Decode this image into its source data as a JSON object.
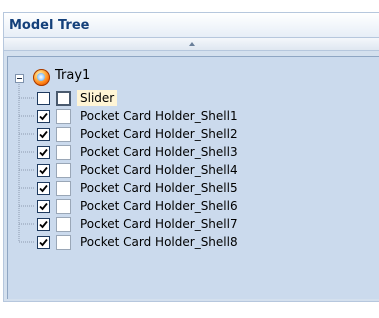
{
  "panel": {
    "title": "Model Tree",
    "collapse_label": "▲"
  },
  "tree": {
    "root": {
      "label": "Tray1",
      "expanded": true,
      "icon": "assembly-icon"
    },
    "items": [
      {
        "label": "Slider",
        "checked": false,
        "selected": true
      },
      {
        "label": "Pocket Card Holder_Shell1",
        "checked": true,
        "selected": false
      },
      {
        "label": "Pocket Card Holder_Shell2",
        "checked": true,
        "selected": false
      },
      {
        "label": "Pocket Card Holder_Shell3",
        "checked": true,
        "selected": false
      },
      {
        "label": "Pocket Card Holder_Shell4",
        "checked": true,
        "selected": false
      },
      {
        "label": "Pocket Card Holder_Shell5",
        "checked": true,
        "selected": false
      },
      {
        "label": "Pocket Card Holder_Shell6",
        "checked": true,
        "selected": false
      },
      {
        "label": "Pocket Card Holder_Shell7",
        "checked": true,
        "selected": false
      },
      {
        "label": "Pocket Card Holder_Shell8",
        "checked": true,
        "selected": false
      }
    ]
  },
  "colors": {
    "panel_bg": "#d4e0ee",
    "tree_bg": "#cbdaed",
    "header_text": "#14407a",
    "selection_bg": "#fff5d6"
  }
}
